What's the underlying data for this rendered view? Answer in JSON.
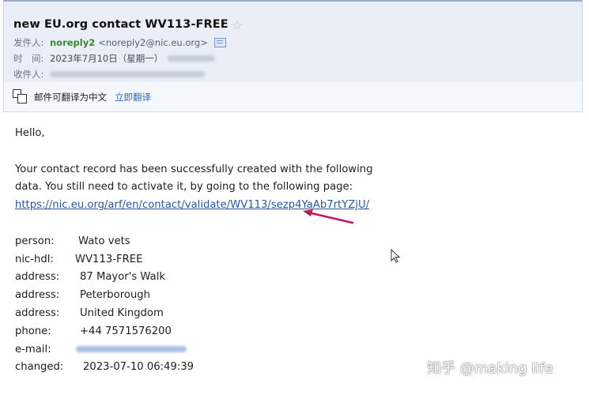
{
  "email": {
    "subject": "new EU.org contact WV113-FREE",
    "from_label": "发件人:",
    "from_name": "noreply2",
    "from_address": "<noreply2@nic.eu.org>",
    "time_label": "时　间:",
    "time_value": "2023年7月10日（星期一）",
    "to_label": "收件人:"
  },
  "translate_bar": {
    "text": "邮件可翻译为中文",
    "action": "立即翻译"
  },
  "body": {
    "greeting": "Hello,",
    "para_line1": "Your contact record has been successfully created with the following",
    "para_line2": "data. You still need to activate it, by going to the following page:",
    "link": "https://nic.eu.org/arf/en/contact/validate/WV113/sezp4YaAb7rtYZjU/",
    "fields": {
      "person_label": "person:",
      "person_value": "Wato vets",
      "nichdl_label": "nic-hdl:",
      "nichdl_value": "WV113-FREE",
      "address1_label": "address:",
      "address1_value": "87 Mayor's Walk",
      "address2_label": "address:",
      "address2_value": "Peterborough",
      "address3_label": "address:",
      "address3_value": "United Kingdom",
      "phone_label": "phone:",
      "phone_value": "+44 7571576200",
      "email_label": "e-mail:",
      "changed_label": "changed:",
      "changed_value": "2023-07-10 06:49:39"
    }
  },
  "watermark": "知乎 @making life",
  "colors": {
    "header_bg": "#e9eef7",
    "sender_green": "#3a8a2c",
    "link_blue": "#2b579a",
    "arrow": "#c2185b"
  }
}
